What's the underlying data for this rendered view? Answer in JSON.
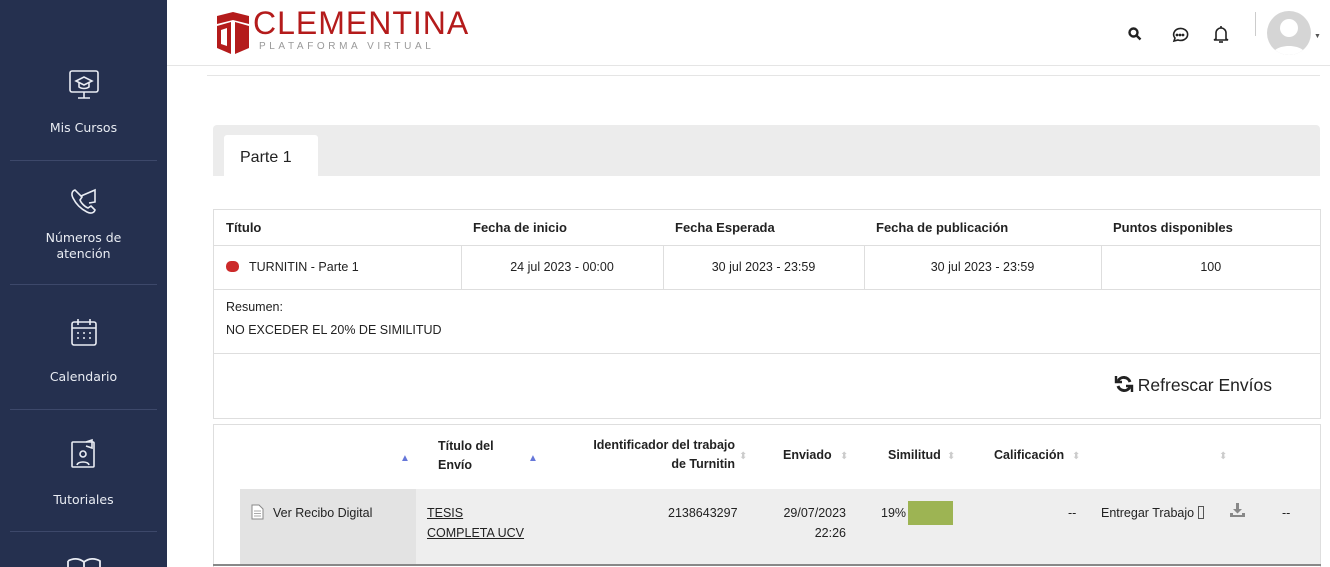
{
  "sidebar": {
    "items": [
      {
        "label": "Mis Cursos",
        "icon": "online-course-monitor-icon"
      },
      {
        "label": "Números de\natención",
        "icon": "phone-message-icon"
      },
      {
        "label": "Calendario",
        "icon": "calendar-icon"
      },
      {
        "label": "Tutoriales",
        "icon": "video-tutorial-icon"
      },
      {
        "label": "",
        "icon": "open-book-icon"
      }
    ]
  },
  "header": {
    "logo_title": "CLEMENTINA",
    "logo_subtitle": "PLATAFORMA VIRTUAL",
    "brand_color": "#b41b1b",
    "icons": [
      "search-icon",
      "chat-icon",
      "bell-icon",
      "avatar"
    ]
  },
  "tabs": [
    {
      "label": "Parte 1",
      "active": true
    }
  ],
  "assignment_table": {
    "headers": [
      "Título",
      "Fecha de inicio",
      "Fecha Esperada",
      "Fecha de publicación",
      "Puntos disponibles"
    ],
    "row": {
      "title": "TURNITIN - Parte 1",
      "start": "24 jul 2023 - 00:00",
      "due": "30 jul 2023 - 23:59",
      "post": "30 jul 2023 - 23:59",
      "points": "100"
    },
    "summary_label": "Resumen:",
    "summary_text": "NO EXCEDER EL 20% DE SIMILITUD"
  },
  "refresh_label": "Refrescar Envíos",
  "submissions": {
    "headers": {
      "title": "Título del Envío",
      "title_l1": "Título del",
      "title_l2": "Envío",
      "turnitin_id": "Identificador del trabajo de Turnitin",
      "turnitin_id_l1": "Identificador del trabajo",
      "turnitin_id_l2": "de Turnitin",
      "sent": "Enviado",
      "similarity": "Similitud",
      "grade": "Calificación"
    },
    "rows": [
      {
        "receipt": "Ver Recibo Digital",
        "title_l1": "TESIS",
        "title_l2": "COMPLETA UCV",
        "turnitin_id": "2138643297",
        "sent_date": "29/07/2023",
        "sent_time": "22:26",
        "similarity": "19%",
        "similarity_color": "#9db453",
        "grade": "--",
        "action": "Entregar Trabajo",
        "extra": "--"
      }
    ]
  }
}
